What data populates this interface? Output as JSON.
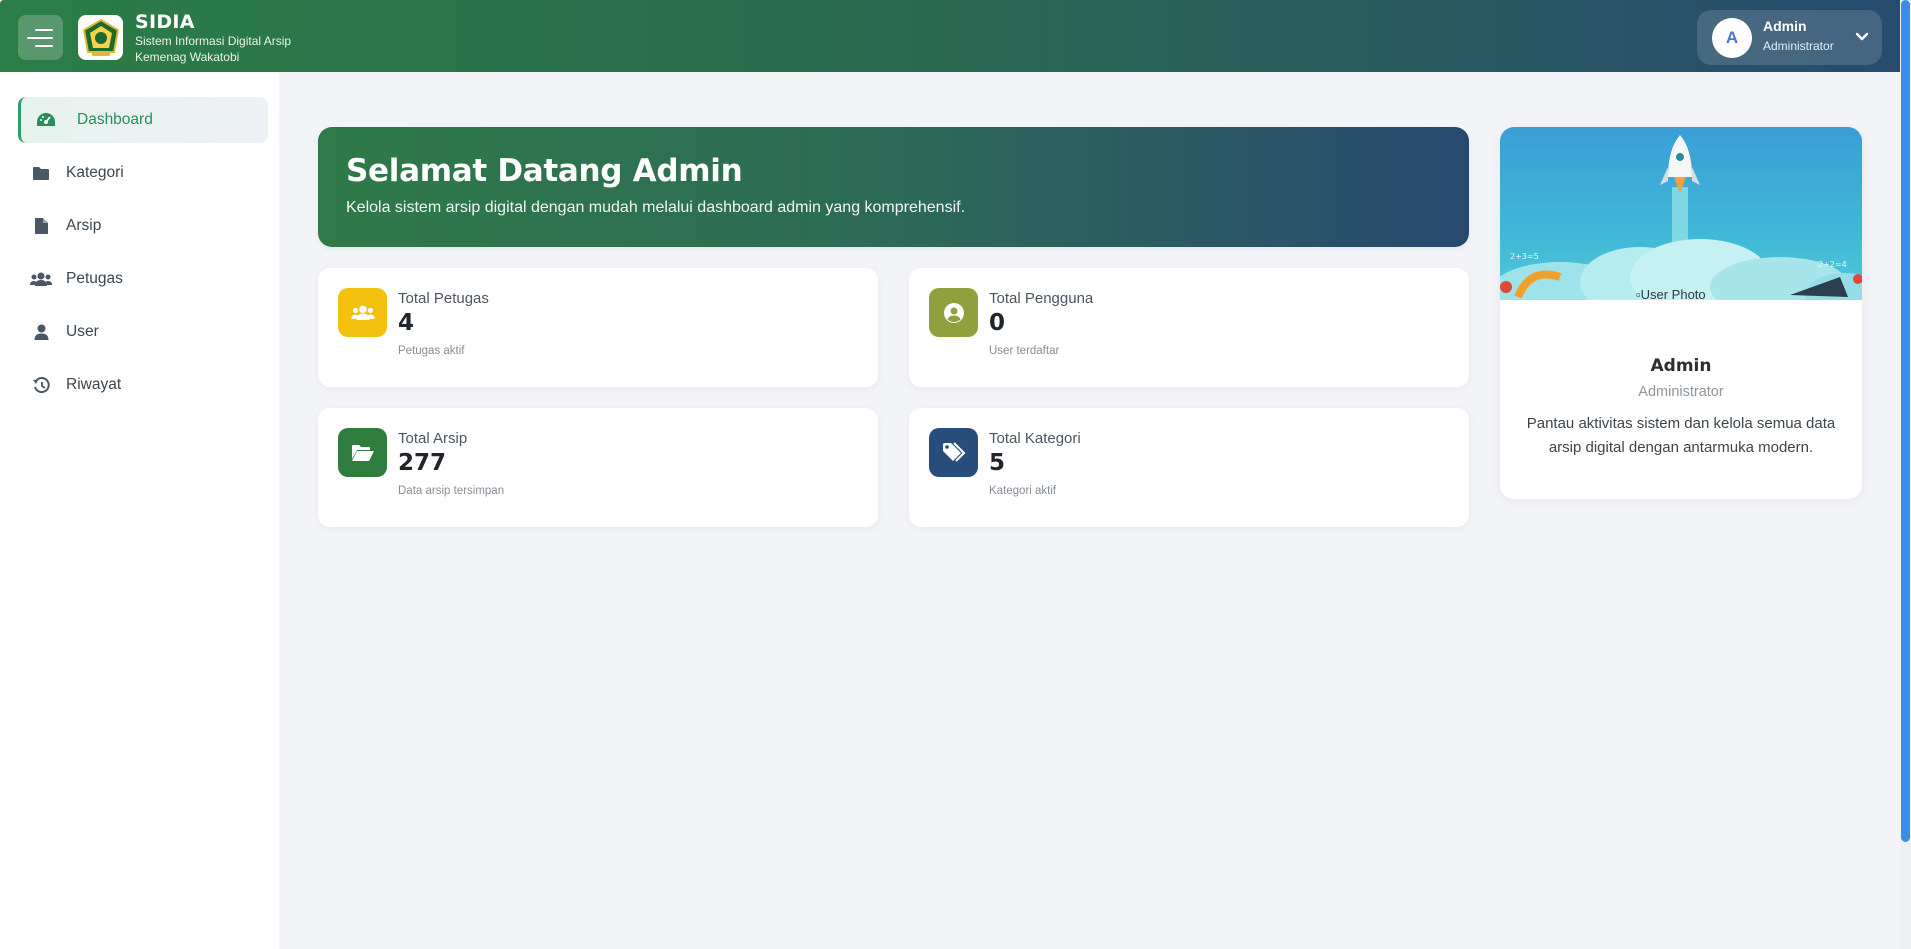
{
  "header": {
    "brand_title": "SIDIA",
    "brand_subtitle_line1": "Sistem Informasi Digital Arsip",
    "brand_subtitle_line2": "Kemenag Wakatobi",
    "user": {
      "initial": "A",
      "name": "Admin",
      "role": "Administrator"
    }
  },
  "sidebar": {
    "items": [
      {
        "label": "Dashboard",
        "icon": "gauge-icon",
        "active": true
      },
      {
        "label": "Kategori",
        "icon": "folder-icon"
      },
      {
        "label": "Arsip",
        "icon": "file-icon"
      },
      {
        "label": "Petugas",
        "icon": "users-icon"
      },
      {
        "label": "User",
        "icon": "user-icon"
      },
      {
        "label": "Riwayat",
        "icon": "history-icon"
      }
    ]
  },
  "welcome": {
    "title": "Selamat Datang Admin",
    "subtitle": "Kelola sistem arsip digital dengan mudah melalui dashboard admin yang komprehensif."
  },
  "stats": [
    {
      "label": "Total Petugas",
      "value": "4",
      "note": "Petugas aktif",
      "icon": "users-icon",
      "color": "#f2c10e"
    },
    {
      "label": "Total Pengguna",
      "value": "0",
      "note": "User terdaftar",
      "icon": "user-circle-icon",
      "color": "#8fa03d"
    },
    {
      "label": "Total Arsip",
      "value": "277",
      "note": "Data arsip tersimpan",
      "icon": "folder-open-icon",
      "color": "#2e7d3f"
    },
    {
      "label": "Total Kategori",
      "value": "5",
      "note": "Kategori aktif",
      "icon": "tags-icon",
      "color": "#284d7a"
    }
  ],
  "profile": {
    "photo_alt": "User Photo",
    "name": "Admin",
    "role": "Administrator",
    "description": "Pantau aktivitas sistem dan kelola semua data arsip digital dengan antarmuka modern."
  },
  "colors": {
    "primary_green": "#2b7d45",
    "primary_blue": "#274b6e",
    "active_nav": "#25905a"
  }
}
